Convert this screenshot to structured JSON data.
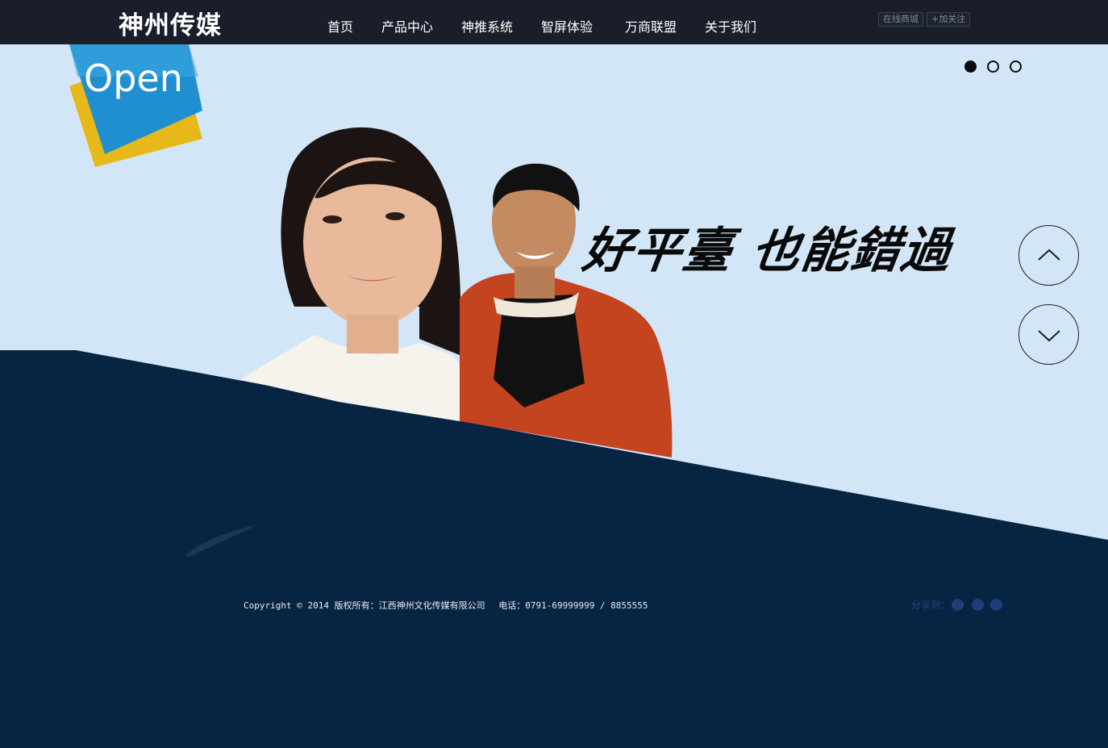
{
  "brand": {
    "logo": "神州传媒"
  },
  "nav": {
    "items": [
      {
        "label": "首页"
      },
      {
        "label": "产品中心"
      },
      {
        "label": "神推系统"
      },
      {
        "label": "智屏体验"
      },
      {
        "label": "万商联盟"
      },
      {
        "label": "关于我们"
      }
    ]
  },
  "top_links": {
    "shop": "在线商城",
    "follow": "+加关注"
  },
  "hero": {
    "badge_text": "Open",
    "slogan": "好平臺 也能錯過",
    "slides": {
      "count": 3,
      "active": 1
    },
    "scroll_up_icon": "chevron-up-icon",
    "scroll_down_icon": "chevron-down-icon"
  },
  "footer": {
    "copyright": "Copyright © 2014 版权所有：江西神州文化传媒有限公司",
    "phone": "电话：0791-69999999 / 8855555",
    "share_label": "分享到：",
    "share_icons": [
      "wechat-icon",
      "weibo-icon",
      "qzone-icon"
    ]
  },
  "colors": {
    "topbar": "#1a1e2a",
    "hero_bg": "#d3e6f7",
    "dark_navy": "#082443",
    "badge_blue": "#1f8fd0",
    "badge_yellow": "#e6b81a",
    "jacket": "#c4441f"
  }
}
